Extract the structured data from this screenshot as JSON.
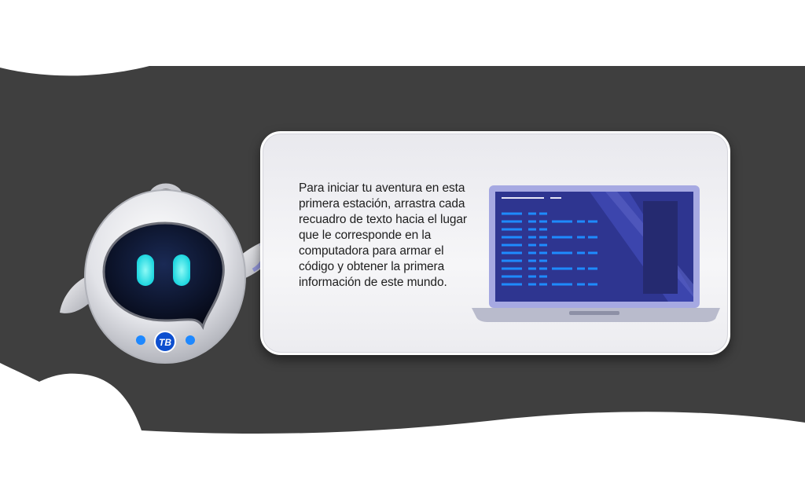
{
  "instruction": {
    "text": "Para iniciar tu aventura en esta primera estación, arrastra cada recuadro de texto hacia el lugar que le corresponde en la computadora para armar el código y obtener la primera información de este mundo."
  },
  "robot": {
    "logo_text": "TB"
  },
  "colors": {
    "band": "#3f3f3f",
    "robot_eye": "#25e6e6",
    "robot_dot": "#1e88ff",
    "laptop_screen": "#333ba4",
    "code_line": "#1e8bff"
  },
  "icons": [
    "robot-mascot-icon",
    "laptop-icon"
  ]
}
